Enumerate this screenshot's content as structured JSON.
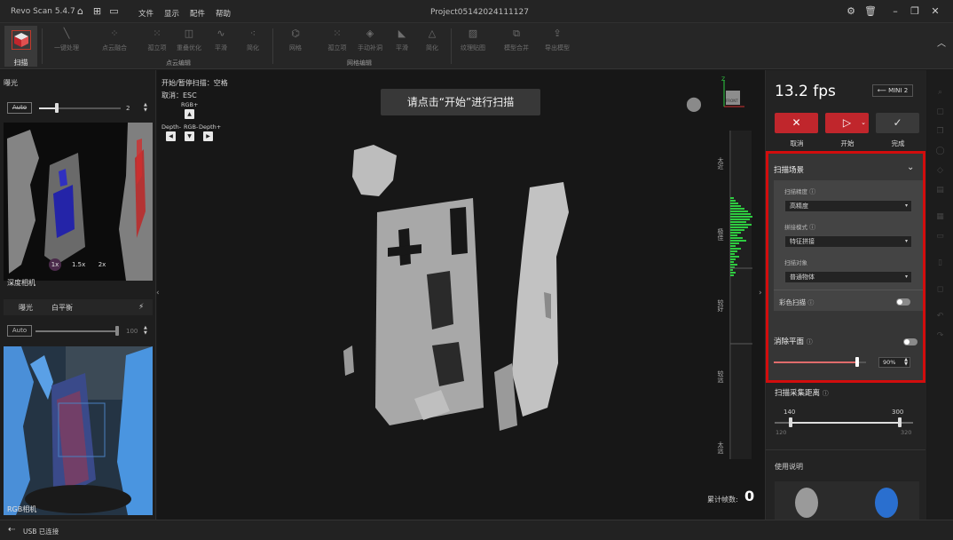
{
  "title_bar": {
    "app_title": "Revo Scan 5.4.7",
    "menus": [
      "文件",
      "显示",
      "配件",
      "帮助"
    ],
    "project": "Project05142024111127"
  },
  "toolbar": {
    "scan_label": "扫描",
    "point_tools": [
      "一键处理",
      "点云融合",
      "孤立项",
      "重叠优化",
      "平滑",
      "简化"
    ],
    "point_group": "点云编辑",
    "mesh_tools": [
      "网格",
      "孤立项",
      "手动补洞",
      "平滑",
      "简化"
    ],
    "mesh_group": "网格编辑",
    "extra_tools": [
      "纹理贴图",
      "模型合并",
      "导出模型"
    ]
  },
  "left_panel": {
    "exposure_title": "曝光",
    "exposure_auto": "Auto",
    "exposure_value": "2",
    "exposure_level": 0.22,
    "depth_camera_label": "深度相机",
    "zoom_levels": [
      "1x",
      "1.5x",
      "2x"
    ],
    "tabs": [
      "曝光",
      "白平衡"
    ],
    "rgb_auto": "Auto",
    "rgb_value": "100",
    "rgb_level": 1.0,
    "rgb_camera_label": "RGB相机"
  },
  "viewport": {
    "hint_lines": [
      "开始/暂停扫描：空格",
      "取消：ESC"
    ],
    "key_labels": [
      "RGB+",
      "Depth-",
      "RGB-",
      "Depth+"
    ],
    "toast": "请点击“开始”进行扫描",
    "ruler_labels": [
      "太近",
      "极佳",
      "较好",
      "较远",
      "太远"
    ],
    "frames_label": "累计帧数:",
    "frames_value": "0",
    "gizmo_label": "FRONT"
  },
  "right_panel": {
    "fps": "13.2 fps",
    "device": "MINI 2",
    "cancel_label": "取消",
    "start_label": "开始",
    "done_label": "完成",
    "scene_title": "扫描场景",
    "precision_label": "扫描精度",
    "precision_value": "高精度",
    "stitch_label": "拼接模式",
    "stitch_value": "特征拼接",
    "object_label": "扫描对象",
    "object_value": "普通物体",
    "color_scan_label": "彩色扫描",
    "remove_plane_label": "消除平面",
    "remove_plane_value": "90%",
    "remove_plane_level": 0.9,
    "distance_title": "扫描采集距离",
    "distance_min_value": "140",
    "distance_max_value": "300",
    "distance_range_min": "120",
    "distance_range_max": "320",
    "help_title": "使用说明"
  },
  "status_bar": {
    "usb_status": "USB 已连接"
  },
  "colors": {
    "accent_red": "#c0262c",
    "highlight_box": "#d20d0d",
    "ruler_green": "#2ecc40"
  }
}
